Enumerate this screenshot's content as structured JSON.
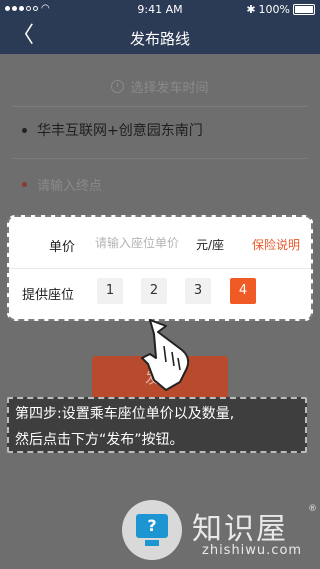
{
  "status_bar": {
    "time": "9:41 AM",
    "battery_text": "100%",
    "bluetooth_glyph": "✱",
    "wifi_glyph": "◠"
  },
  "nav": {
    "back_glyph": "〈",
    "title": "发布路线"
  },
  "form": {
    "time_placeholder": "选择发车时间",
    "start_location": "华丰互联网+创意园东南门",
    "end_placeholder": "请输入终点"
  },
  "seat_panel": {
    "price_label": "单价",
    "price_placeholder": "请输入座位单价",
    "price_unit": "元/座",
    "insurance_link": "保险说明",
    "seats_label": "提供座位",
    "seat_options": [
      "1",
      "2",
      "3",
      "4"
    ],
    "selected_seat": "4"
  },
  "publish_button": "发布",
  "tip": {
    "line1": "第四步:设置乘车座位单价以及数量,",
    "line2": "然后点击下方“发布”按钮。"
  },
  "watermark": {
    "brand": "知识屋",
    "registered": "®",
    "url": "zhishiwu.com",
    "badge_glyph": "?"
  },
  "colors": {
    "nav_bg": "#2b3a55",
    "accent": "#f05a24",
    "publish_bg": "#b84a2e",
    "watermark_blue": "#1d95d3"
  },
  "icons": {
    "back": "chevron-left-icon",
    "clock": "clock-icon",
    "hand": "tap-hand-icon"
  }
}
